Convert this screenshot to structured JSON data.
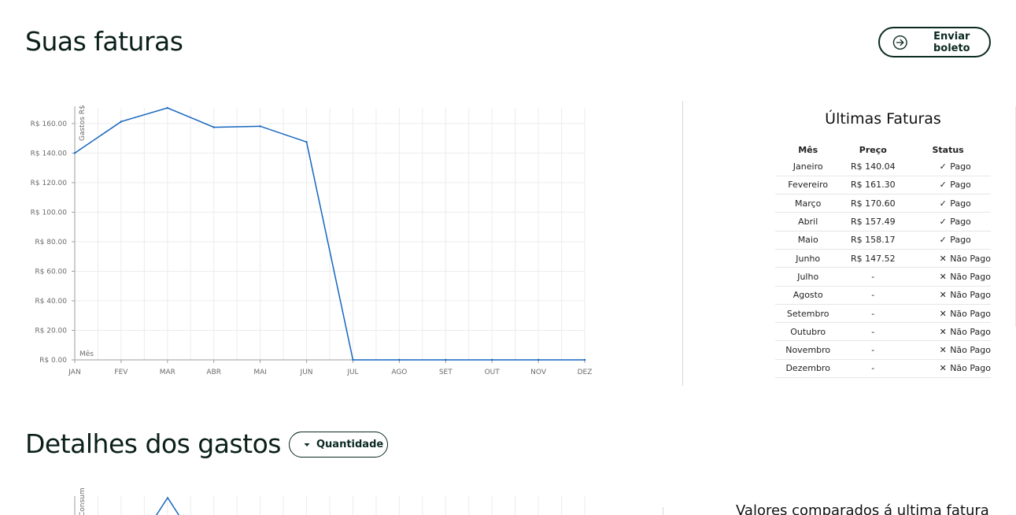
{
  "section1": {
    "title": "Suas faturas",
    "send_button_label": "Enviar boleto"
  },
  "section2": {
    "title": "Detalhes dos gastos",
    "filter_label": "Quantidade",
    "comparison_title": "Valores comparados á ultima fatura",
    "y_axis_label": "Consumo kWh"
  },
  "chart_data": {
    "type": "line",
    "categories": [
      "JAN",
      "FEV",
      "MAR",
      "ABR",
      "MAI",
      "JUN",
      "JUL",
      "AGO",
      "SET",
      "OUT",
      "NOV",
      "DEZ"
    ],
    "values": [
      140.04,
      161.3,
      170.6,
      157.49,
      158.17,
      147.52,
      0,
      0,
      0,
      0,
      0,
      0
    ],
    "y_ticks": [
      "R$ 0.00",
      "R$ 20.00",
      "R$ 40.00",
      "R$ 60.00",
      "R$ 80.00",
      "R$ 100.00",
      "R$ 120.00",
      "R$ 140.00",
      "R$ 160.00"
    ],
    "ylim": [
      0,
      170.6
    ],
    "ylabel": "Gastos R$",
    "xlabel": "Mês",
    "grid": true,
    "line_color": "#1565c0"
  },
  "invoices": {
    "title": "Últimas Faturas",
    "headers": [
      "Mês",
      "Preço",
      "Status"
    ],
    "rows": [
      {
        "month": "Janeiro",
        "price": "R$ 140.04",
        "status": "Pago",
        "paid": true
      },
      {
        "month": "Fevereiro",
        "price": "R$ 161.30",
        "status": "Pago",
        "paid": true
      },
      {
        "month": "Março",
        "price": "R$ 170.60",
        "status": "Pago",
        "paid": true
      },
      {
        "month": "Abril",
        "price": "R$ 157.49",
        "status": "Pago",
        "paid": true
      },
      {
        "month": "Maio",
        "price": "R$ 158.17",
        "status": "Pago",
        "paid": true
      },
      {
        "month": "Junho",
        "price": "R$ 147.52",
        "status": "Não Pago",
        "paid": false
      },
      {
        "month": "Julho",
        "price": "-",
        "status": "Não Pago",
        "paid": false
      },
      {
        "month": "Agosto",
        "price": "-",
        "status": "Não Pago",
        "paid": false
      },
      {
        "month": "Setembro",
        "price": "-",
        "status": "Não Pago",
        "paid": false
      },
      {
        "month": "Outubro",
        "price": "-",
        "status": "Não Pago",
        "paid": false
      },
      {
        "month": "Novembro",
        "price": "-",
        "status": "Não Pago",
        "paid": false
      },
      {
        "month": "Dezembro",
        "price": "-",
        "status": "Não Pago",
        "paid": false
      }
    ]
  }
}
